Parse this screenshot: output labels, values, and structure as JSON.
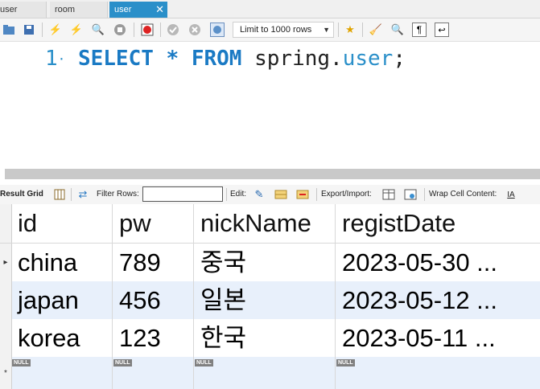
{
  "tabs": [
    {
      "label": "user",
      "active": false
    },
    {
      "label": "room",
      "active": false
    },
    {
      "label": "user",
      "active": true
    }
  ],
  "toolbar": {
    "limit_select": "Limit to 1000 rows"
  },
  "editor": {
    "line_number": "1",
    "bullet": "·",
    "kw_select": "SELECT",
    "star": "*",
    "kw_from": "FROM",
    "schema": "spring",
    "dot": ".",
    "table": "user",
    "semicolon": ";"
  },
  "result_toolbar": {
    "result_grid": "Result Grid",
    "filter_rows": "Filter Rows:",
    "filter_value": "",
    "edit": "Edit:",
    "export_import": "Export/Import:",
    "wrap_cell": "Wrap Cell Content:"
  },
  "grid": {
    "columns": [
      "id",
      "pw",
      "nickName",
      "registDate"
    ],
    "rows": [
      {
        "id": "china",
        "pw": "789",
        "nickName": "중국",
        "registDate": "2023-05-30 ..."
      },
      {
        "id": "japan",
        "pw": "456",
        "nickName": "일본",
        "registDate": "2023-05-12 ..."
      },
      {
        "id": "korea",
        "pw": "123",
        "nickName": "한국",
        "registDate": "2023-05-11 ..."
      }
    ],
    "null_label": "NULL",
    "new_row_marker": "*",
    "current_row_marker": "▸"
  },
  "colors": {
    "active_tab": "#2a8fc9",
    "keyword": "#1a7ac4",
    "alt_row": "#e8f0fb"
  }
}
